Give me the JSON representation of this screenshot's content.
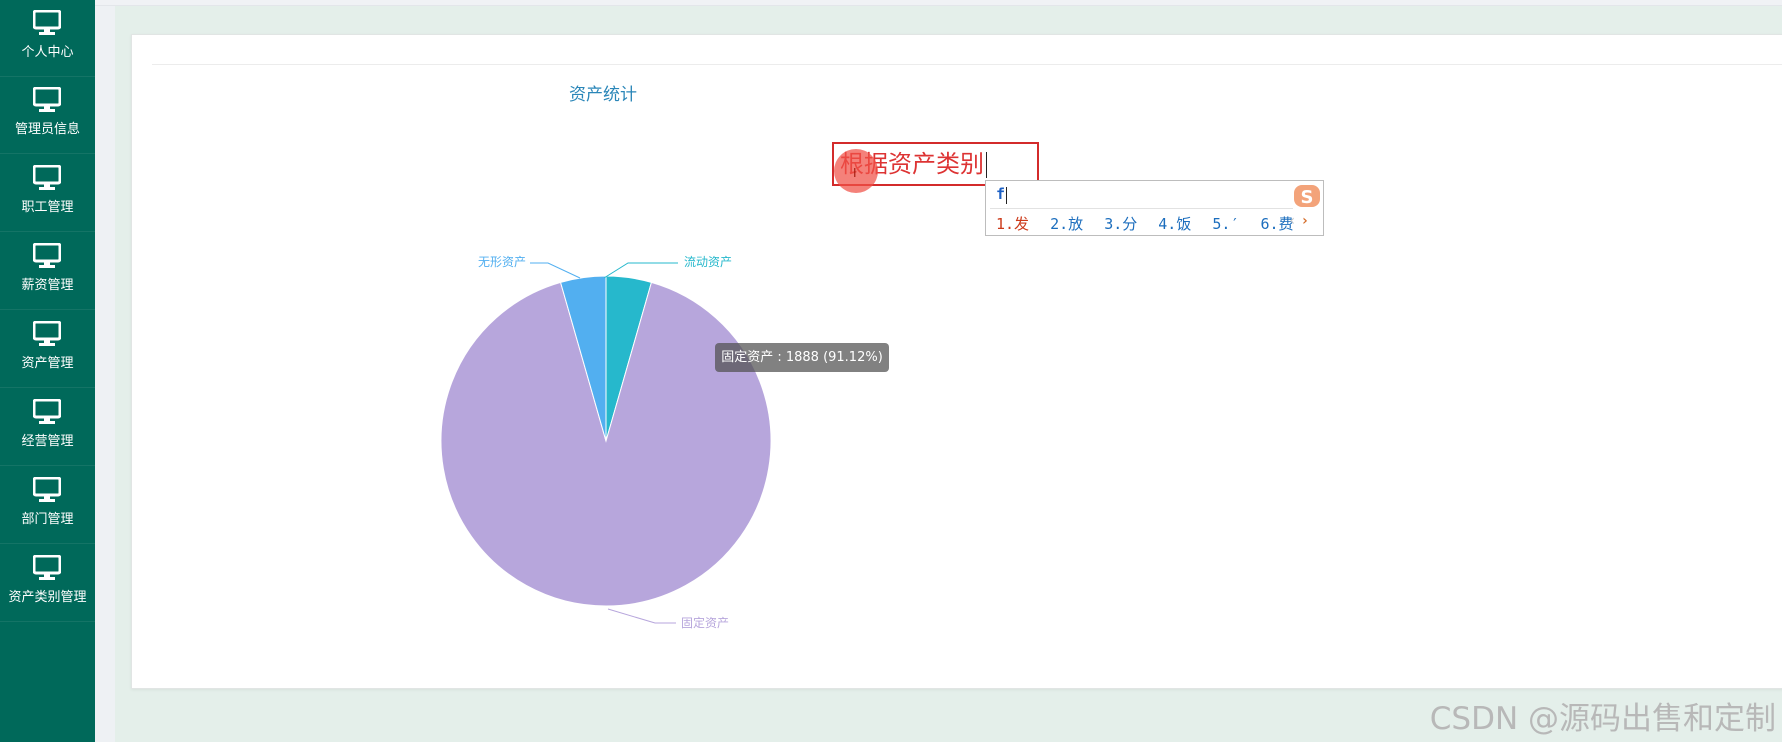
{
  "sidebar": {
    "items": [
      {
        "label": "个人中心",
        "icon": "monitor-icon"
      },
      {
        "label": "管理员信息",
        "icon": "monitor-icon"
      },
      {
        "label": "职工管理",
        "icon": "monitor-icon"
      },
      {
        "label": "薪资管理",
        "icon": "monitor-icon"
      },
      {
        "label": "资产管理",
        "icon": "monitor-icon"
      },
      {
        "label": "经营管理",
        "icon": "monitor-icon"
      },
      {
        "label": "部门管理",
        "icon": "monitor-icon"
      },
      {
        "label": "资产类别管理",
        "icon": "monitor-icon"
      }
    ]
  },
  "main": {
    "title": "资产统计",
    "category_field": {
      "value": "根据资产类别"
    }
  },
  "ime": {
    "input": "f",
    "candidates": [
      "1.发",
      "2.放",
      "3.分",
      "4.饭",
      "5.′",
      "6.费"
    ],
    "prev_icon": "chevron-left-icon",
    "next_icon": "chevron-right-icon",
    "logo_icon": "sogou-logo-icon"
  },
  "chart_data": {
    "type": "pie",
    "title": "",
    "series": [
      {
        "name": "流动资产",
        "color": "#26b8cc"
      },
      {
        "name": "无形资产",
        "color": "#52aff0"
      },
      {
        "name": "固定资产",
        "value": 1888,
        "percent": 91.12,
        "color": "#b7a6dc"
      }
    ],
    "tooltip": "固定资产 : 1888 (91.12%)"
  },
  "watermark": "CSDN @源码出售和定制"
}
